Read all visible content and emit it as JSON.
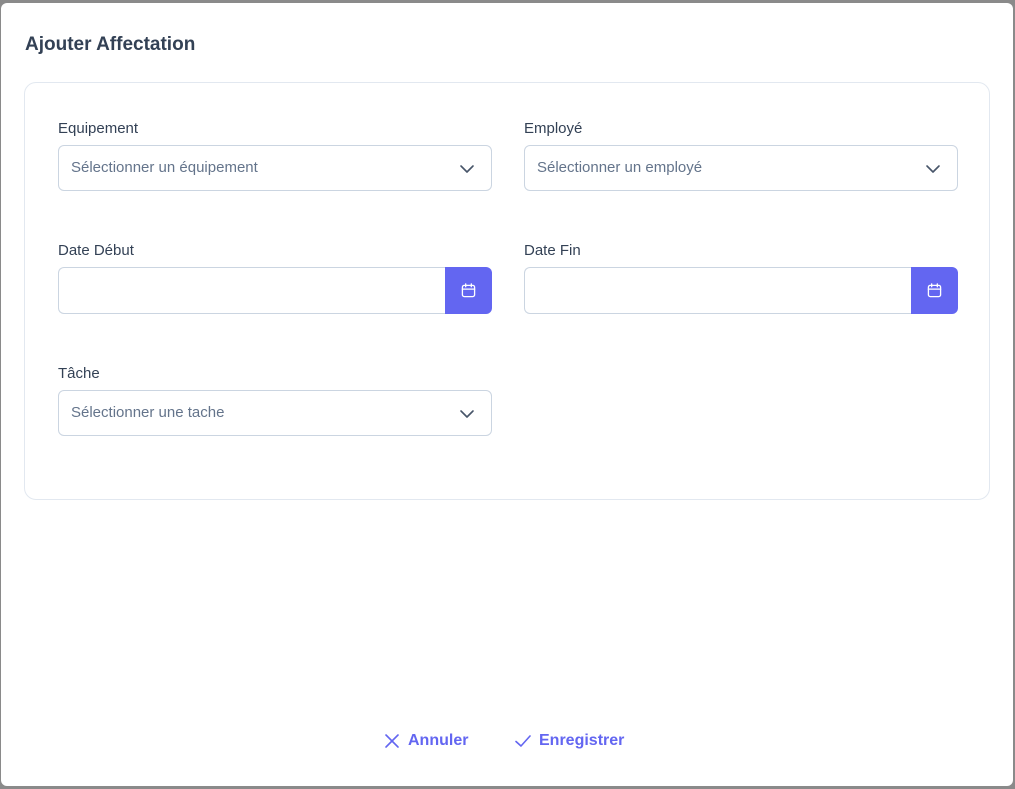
{
  "dialog": {
    "title": "Ajouter Affectation"
  },
  "form": {
    "equipement": {
      "label": "Equipement",
      "placeholder": "Sélectionner un équipement"
    },
    "employe": {
      "label": "Employé",
      "placeholder": "Sélectionner un employé"
    },
    "date_debut": {
      "label": "Date Début",
      "value": ""
    },
    "date_fin": {
      "label": "Date Fin",
      "value": ""
    },
    "tache": {
      "label": "Tâche",
      "placeholder": "Sélectionner une tache"
    }
  },
  "footer": {
    "cancel_label": "Annuler",
    "save_label": "Enregistrer"
  },
  "colors": {
    "accent": "#6366f1",
    "text": "#334155",
    "placeholder": "#64748b",
    "border": "#cbd5e1"
  },
  "icons": {
    "dropdown": "chevron-down-icon",
    "calendar": "calendar-icon",
    "cancel": "close-icon",
    "save": "check-icon"
  }
}
